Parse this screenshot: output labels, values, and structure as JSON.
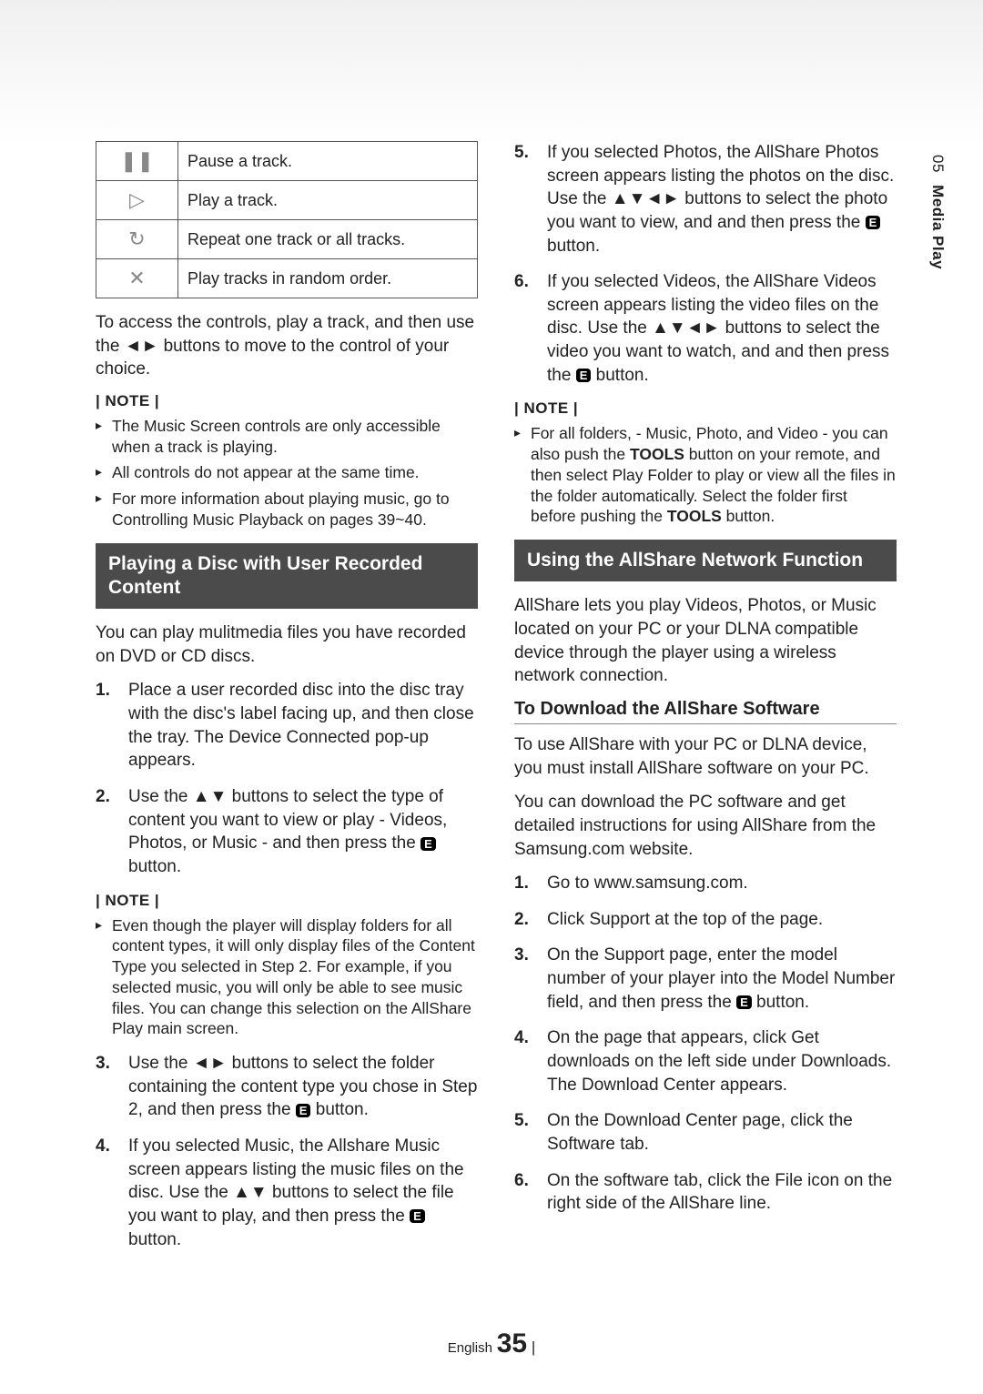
{
  "sideTab": {
    "chapter": "05",
    "title": "Media Play"
  },
  "controlsTable": [
    {
      "icon": "❚❚",
      "label": "Pause a track."
    },
    {
      "icon": "▷",
      "label": "Play a track."
    },
    {
      "icon": "↻",
      "label": "Repeat one track or all tracks."
    },
    {
      "icon": "✕",
      "label": "Play tracks in random order."
    }
  ],
  "accessPara": "To access the controls, play a track, and then use the ◄► buttons to move to the control of your choice.",
  "noteLabel": "| NOTE |",
  "leftNotes1": [
    "The Music Screen controls are only accessible when a track is playing.",
    "All controls do not appear at the same time.",
    "For more information about playing music, go to Controlling Music Playback on pages 39~40."
  ],
  "section1Title": "Playing a Disc with User Recorded Content",
  "section1Intro": "You can play mulitmedia files you have recorded on DVD or CD discs.",
  "section1Steps": {
    "s1": "Place a user recorded disc into the disc tray with the disc's label facing up, and then close the tray. The Device Connected pop-up appears.",
    "s2a": "Use the ▲▼ buttons to select the type of content you want to view or play - Videos, Photos, or Music - and then press the ",
    "s2b": " button.",
    "s3a": "Use the ◄► buttons to select the folder containing the content type you chose in Step 2, and then press the ",
    "s3b": " button.",
    "s4a": "If you selected Music, the Allshare Music screen appears listing the music files on the disc. Use the ▲▼ buttons to select the file you want to play, and then press the ",
    "s4b": " button.",
    "s5a": "If you selected Photos, the AllShare Photos screen appears listing the photos on the disc. Use the ▲▼◄► buttons to select the photo you want to view, and and then press the ",
    "s5b": " button.",
    "s6a": "If you selected Videos, the AllShare Videos screen appears listing the video files on the disc. Use the ▲▼◄► buttons to select the video you want to watch, and and then press the ",
    "s6b": " button."
  },
  "midNote": "Even though the player will display folders for all content types, it will only display files of the Content Type you selected in Step 2. For example, if you selected music, you will only be able to see music files. You can change this selection on the AllShare Play main screen.",
  "rightNote": {
    "a": "For all folders, - Music, Photo, and Video - you can also push the ",
    "tools": "TOOLS",
    "b": " button on your remote, and then select Play Folder to play or view all the files in the folder automatically. Select the folder first before pushing the ",
    "c": " button."
  },
  "section2Title": "Using the AllShare Network Function",
  "section2Intro": "AllShare lets you play Videos, Photos, or Music located on your PC or your DLNA compatible device through the player using a wireless network connection.",
  "subHeading": "To Download the AllShare Software",
  "dlPara1": "To use AllShare with your PC or DLNA device, you must install AllShare software on your PC.",
  "dlPara2": "You can download the PC software and get detailed instructions for using AllShare from the Samsung.com website.",
  "dlSteps": {
    "s1": "Go to www.samsung.com.",
    "s2": "Click Support at the top of the page.",
    "s3a": "On the Support page, enter the model number of your player into the Model Number field, and then press the ",
    "s3b": " button.",
    "s4": "On the page that appears, click Get downloads on the left side under Downloads. The Download Center appears.",
    "s5": "On the Download Center page, click the Software tab.",
    "s6": "On the software tab, click the File icon on the right side of the AllShare line."
  },
  "enterGlyph": "E",
  "footer": {
    "lang": "English",
    "page": "35",
    "bar": "|"
  }
}
